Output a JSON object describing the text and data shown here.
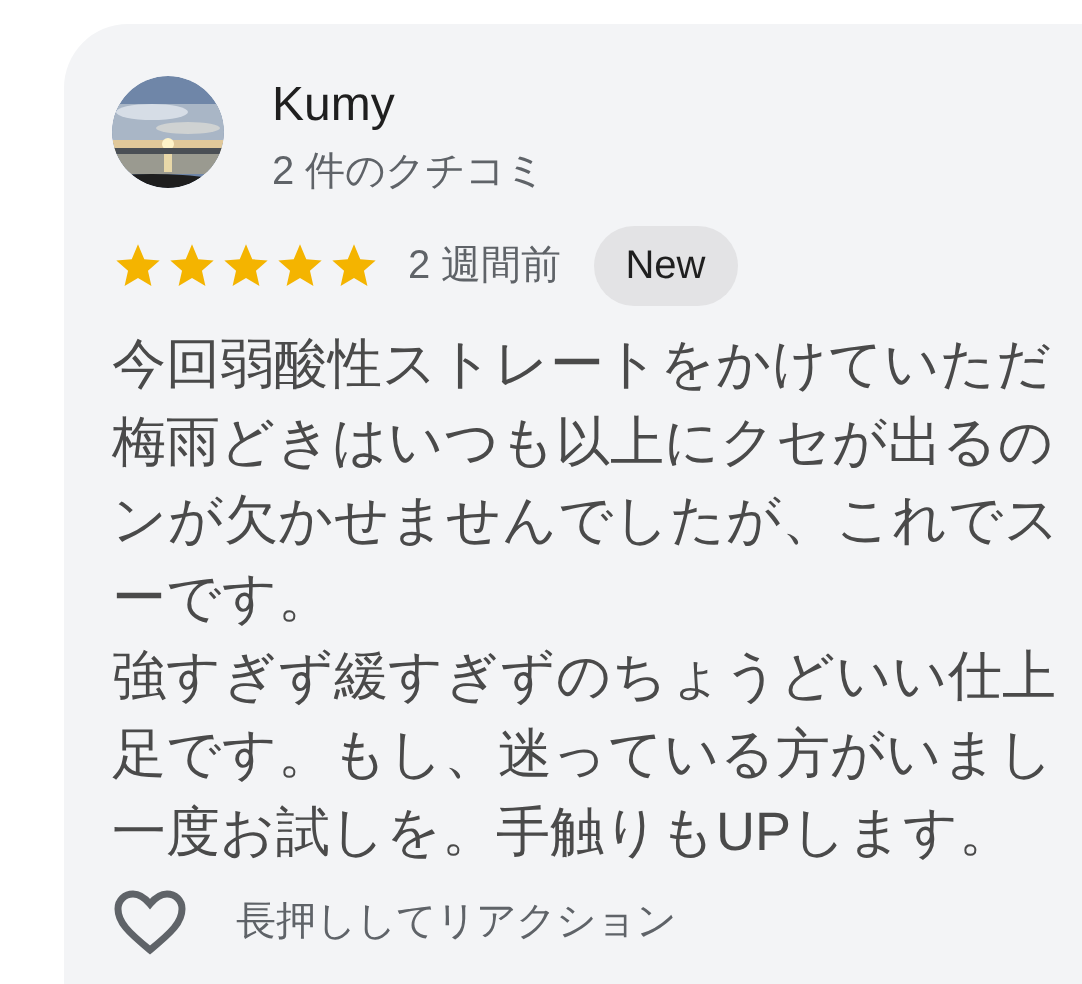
{
  "review": {
    "author": "Kumy",
    "review_count": "2 件のクチコミ",
    "stars": 5,
    "time": "2 週間前",
    "badge": "New",
    "text_lines": [
      "今回弱酸性ストレートをかけていただ",
      "梅雨どきはいつも以上にクセが出るの",
      "ンが欠かせませんでしたが、これでス",
      "ーです。",
      "強すぎず緩すぎずのちょうどいい仕上",
      "足です。もし、迷っている方がいまし",
      "一度お試しを。手触りもUPします。"
    ],
    "reaction_hint": "長押ししてリアクション"
  }
}
